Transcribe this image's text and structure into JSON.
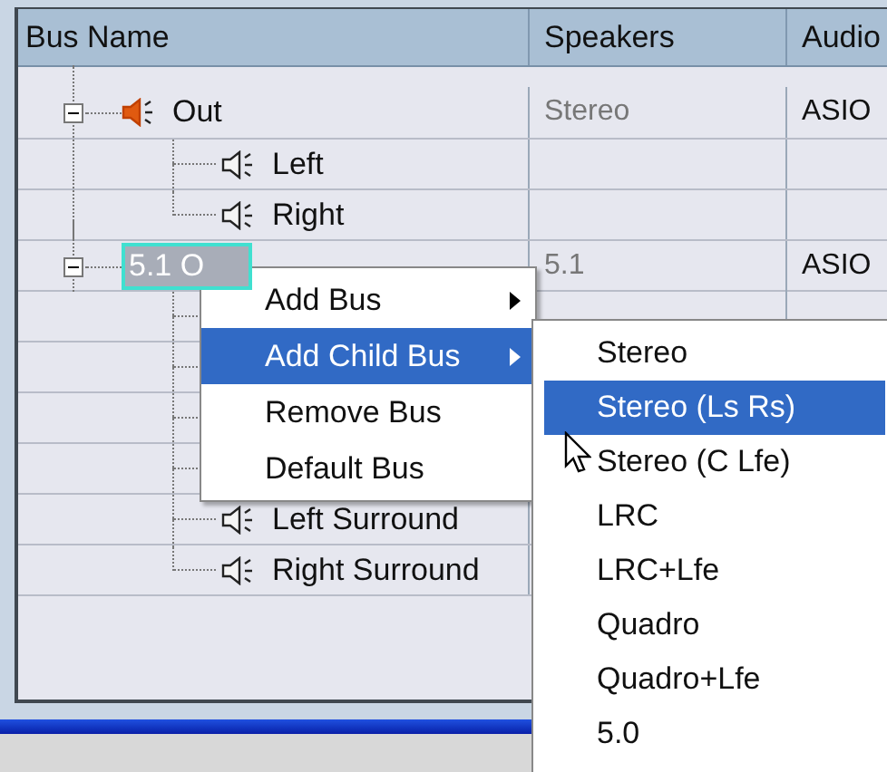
{
  "table": {
    "columns": [
      "Bus Name",
      "Speakers",
      "Audio"
    ],
    "rows": [
      {
        "name": "Out",
        "speakers": "Stereo",
        "audio": "ASIO",
        "expanded": true,
        "editing": false,
        "children": [
          {
            "kind": "channel",
            "name": "Left"
          },
          {
            "kind": "channel",
            "name": "Right"
          }
        ]
      },
      {
        "name": "5.1 O",
        "speakers": "5.1",
        "audio": "ASIO",
        "expanded": true,
        "editing": true,
        "children": [
          {
            "kind": "covered"
          },
          {
            "kind": "covered"
          },
          {
            "kind": "covered"
          },
          {
            "kind": "covered"
          },
          {
            "kind": "channel",
            "name": "Left Surround"
          },
          {
            "kind": "channel",
            "name": "Right Surround"
          }
        ]
      }
    ]
  },
  "context_menu": {
    "items": [
      {
        "label": "Add Bus",
        "submenu": true,
        "selected": false
      },
      {
        "label": "Add Child Bus",
        "submenu": true,
        "selected": true
      },
      {
        "label": "Remove Bus",
        "submenu": false,
        "selected": false
      },
      {
        "label": "Default Bus",
        "submenu": false,
        "selected": false
      }
    ]
  },
  "submenu": {
    "items": [
      {
        "label": "Stereo",
        "selected": false
      },
      {
        "label": "Stereo (Ls Rs)",
        "selected": true
      },
      {
        "label": "Stereo (C Lfe)",
        "selected": false
      },
      {
        "label": "LRC",
        "selected": false
      },
      {
        "label": "LRC+Lfe",
        "selected": false
      },
      {
        "label": "Quadro",
        "selected": false
      },
      {
        "label": "Quadro+Lfe",
        "selected": false
      },
      {
        "label": "5.0",
        "selected": false
      }
    ]
  }
}
